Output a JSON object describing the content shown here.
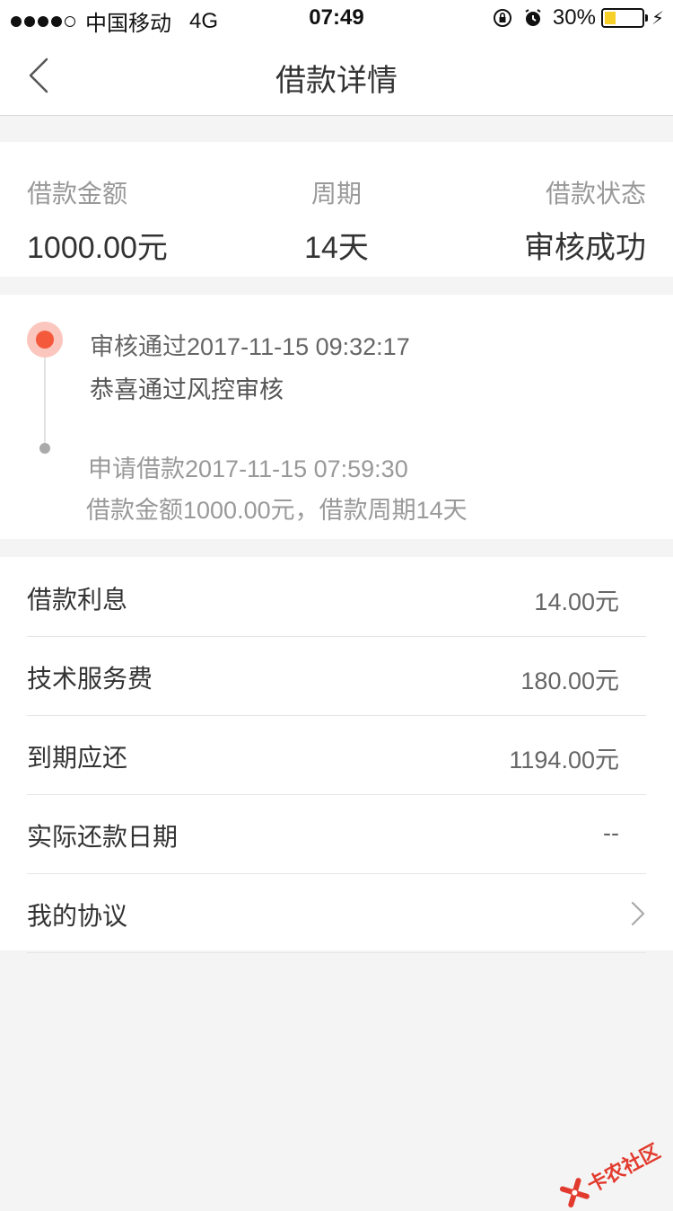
{
  "status_bar": {
    "carrier": "中国移动",
    "network": "4G",
    "time": "07:49",
    "battery_percent": "30%",
    "battery_level": 0.3
  },
  "nav": {
    "title": "借款详情",
    "back_icon": "chevron-left-icon"
  },
  "summary": {
    "amount_label": "借款金额",
    "amount_value": "1000.00元",
    "period_label": "周期",
    "period_value": "14天",
    "status_label": "借款状态",
    "status_value": "审核成功"
  },
  "timeline": {
    "events": [
      {
        "title": "审核通过2017-11-15 09:32:17",
        "desc": "恭喜通过风控审核",
        "active": true
      },
      {
        "title": "申请借款2017-11-15 07:59:30",
        "desc": "借款金额1000.00元，借款周期14天",
        "active": false
      }
    ]
  },
  "details": {
    "rows": [
      {
        "label": "借款利息",
        "value": "14.00元"
      },
      {
        "label": "技术服务费",
        "value": "180.00元"
      },
      {
        "label": "到期应还",
        "value": "1194.00元"
      },
      {
        "label": "实际还款日期",
        "value": "--"
      },
      {
        "label": "我的协议",
        "value": ""
      }
    ]
  },
  "watermark": {
    "text": "卡农社区"
  },
  "colors": {
    "accent": "#f4593c",
    "accent_light": "#fbc6bd",
    "background": "#f4f4f4",
    "battery": "#f8d02a"
  }
}
